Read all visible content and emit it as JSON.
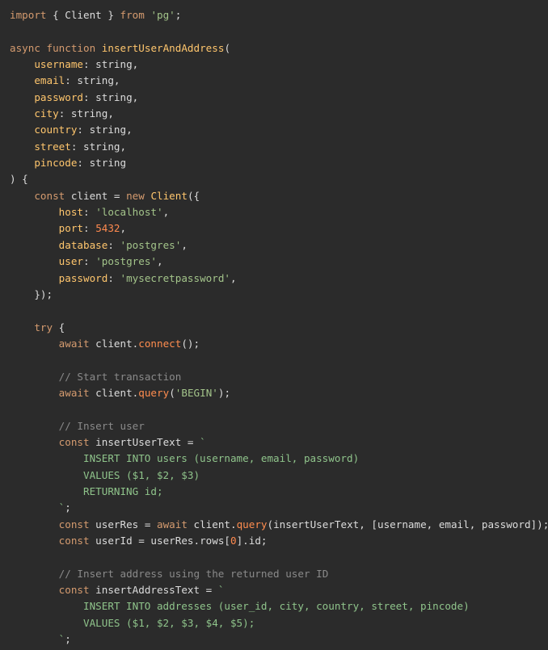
{
  "editor": {
    "background": "#2b2b2b",
    "token_colors": {
      "plain": "#dcdcdc",
      "keyword": "#d59b6f",
      "function": "#ffc66d",
      "string": "#a3c48a",
      "number": "#ff8a4f",
      "comment": "#8a8a8a",
      "property": "#ffc66d",
      "method": "#ff8d4f",
      "punctuation": "#dcdcdc",
      "template": "#8fc48b"
    },
    "lines": [
      [
        [
          "keyword",
          "import"
        ],
        [
          "plain",
          " { Client } "
        ],
        [
          "keyword",
          "from"
        ],
        [
          "plain",
          " "
        ],
        [
          "string",
          "'pg'"
        ],
        [
          "plain",
          ";"
        ]
      ],
      [],
      [
        [
          "keyword",
          "async"
        ],
        [
          "plain",
          " "
        ],
        [
          "keyword",
          "function"
        ],
        [
          "plain",
          " "
        ],
        [
          "function",
          "insertUserAndAddress"
        ],
        [
          "plain",
          "("
        ]
      ],
      [
        [
          "plain",
          "    "
        ],
        [
          "property",
          "username"
        ],
        [
          "plain",
          ": string,"
        ]
      ],
      [
        [
          "plain",
          "    "
        ],
        [
          "property",
          "email"
        ],
        [
          "plain",
          ": string,"
        ]
      ],
      [
        [
          "plain",
          "    "
        ],
        [
          "property",
          "password"
        ],
        [
          "plain",
          ": string,"
        ]
      ],
      [
        [
          "plain",
          "    "
        ],
        [
          "property",
          "city"
        ],
        [
          "plain",
          ": string,"
        ]
      ],
      [
        [
          "plain",
          "    "
        ],
        [
          "property",
          "country"
        ],
        [
          "plain",
          ": string,"
        ]
      ],
      [
        [
          "plain",
          "    "
        ],
        [
          "property",
          "street"
        ],
        [
          "plain",
          ": string,"
        ]
      ],
      [
        [
          "plain",
          "    "
        ],
        [
          "property",
          "pincode"
        ],
        [
          "plain",
          ": string"
        ]
      ],
      [
        [
          "plain",
          ") {"
        ]
      ],
      [
        [
          "plain",
          "    "
        ],
        [
          "keyword",
          "const"
        ],
        [
          "plain",
          " client = "
        ],
        [
          "keyword",
          "new"
        ],
        [
          "plain",
          " "
        ],
        [
          "function",
          "Client"
        ],
        [
          "plain",
          "({"
        ]
      ],
      [
        [
          "plain",
          "        "
        ],
        [
          "property",
          "host"
        ],
        [
          "plain",
          ": "
        ],
        [
          "string",
          "'localhost'"
        ],
        [
          "plain",
          ","
        ]
      ],
      [
        [
          "plain",
          "        "
        ],
        [
          "property",
          "port"
        ],
        [
          "plain",
          ": "
        ],
        [
          "number",
          "5432"
        ],
        [
          "plain",
          ","
        ]
      ],
      [
        [
          "plain",
          "        "
        ],
        [
          "property",
          "database"
        ],
        [
          "plain",
          ": "
        ],
        [
          "string",
          "'postgres'"
        ],
        [
          "plain",
          ","
        ]
      ],
      [
        [
          "plain",
          "        "
        ],
        [
          "property",
          "user"
        ],
        [
          "plain",
          ": "
        ],
        [
          "string",
          "'postgres'"
        ],
        [
          "plain",
          ","
        ]
      ],
      [
        [
          "plain",
          "        "
        ],
        [
          "property",
          "password"
        ],
        [
          "plain",
          ": "
        ],
        [
          "string",
          "'mysecretpassword'"
        ],
        [
          "plain",
          ","
        ]
      ],
      [
        [
          "plain",
          "    });"
        ]
      ],
      [],
      [
        [
          "plain",
          "    "
        ],
        [
          "keyword",
          "try"
        ],
        [
          "plain",
          " {"
        ]
      ],
      [
        [
          "plain",
          "        "
        ],
        [
          "keyword",
          "await"
        ],
        [
          "plain",
          " client."
        ],
        [
          "method",
          "connect"
        ],
        [
          "plain",
          "();"
        ]
      ],
      [],
      [
        [
          "plain",
          "        "
        ],
        [
          "comment",
          "// Start transaction"
        ]
      ],
      [
        [
          "plain",
          "        "
        ],
        [
          "keyword",
          "await"
        ],
        [
          "plain",
          " client."
        ],
        [
          "method",
          "query"
        ],
        [
          "plain",
          "("
        ],
        [
          "string",
          "'BEGIN'"
        ],
        [
          "plain",
          ");"
        ]
      ],
      [],
      [
        [
          "plain",
          "        "
        ],
        [
          "comment",
          "// Insert user"
        ]
      ],
      [
        [
          "plain",
          "        "
        ],
        [
          "keyword",
          "const"
        ],
        [
          "plain",
          " insertUserText = "
        ],
        [
          "template",
          "`"
        ]
      ],
      [
        [
          "template",
          "            INSERT INTO users (username, email, password)"
        ]
      ],
      [
        [
          "template",
          "            VALUES ($1, $2, $3)"
        ]
      ],
      [
        [
          "template",
          "            RETURNING id;"
        ]
      ],
      [
        [
          "template",
          "        `"
        ],
        [
          "plain",
          ";"
        ]
      ],
      [
        [
          "plain",
          "        "
        ],
        [
          "keyword",
          "const"
        ],
        [
          "plain",
          " userRes = "
        ],
        [
          "keyword",
          "await"
        ],
        [
          "plain",
          " client."
        ],
        [
          "method",
          "query"
        ],
        [
          "plain",
          "(insertUserText, [username, email, password]);"
        ]
      ],
      [
        [
          "plain",
          "        "
        ],
        [
          "keyword",
          "const"
        ],
        [
          "plain",
          " userId = userRes.rows["
        ],
        [
          "number",
          "0"
        ],
        [
          "plain",
          "].id;"
        ]
      ],
      [],
      [
        [
          "plain",
          "        "
        ],
        [
          "comment",
          "// Insert address using the returned user ID"
        ]
      ],
      [
        [
          "plain",
          "        "
        ],
        [
          "keyword",
          "const"
        ],
        [
          "plain",
          " insertAddressText = "
        ],
        [
          "template",
          "`"
        ]
      ],
      [
        [
          "template",
          "            INSERT INTO addresses (user_id, city, country, street, pincode)"
        ]
      ],
      [
        [
          "template",
          "            VALUES ($1, $2, $3, $4, $5);"
        ]
      ],
      [
        [
          "template",
          "        `"
        ],
        [
          "plain",
          ";"
        ]
      ]
    ]
  }
}
